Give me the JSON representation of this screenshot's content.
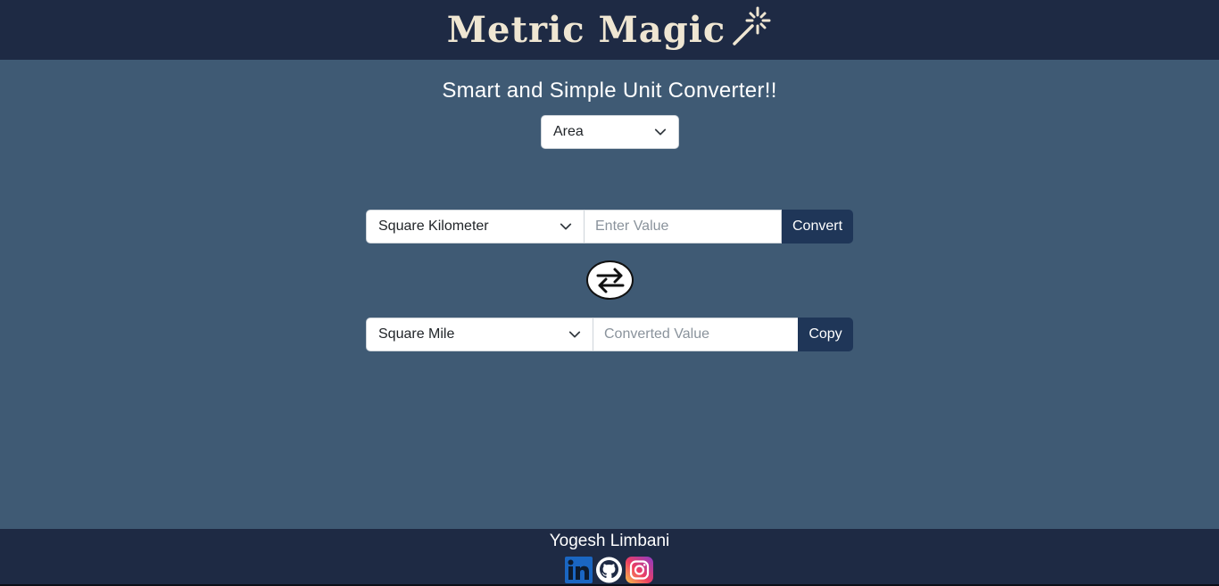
{
  "header": {
    "title": "Metric Magic",
    "logo_icon": "magic-wand-icon"
  },
  "main": {
    "subtitle": "Smart and Simple Unit Converter!!",
    "category_select": {
      "value": "Area"
    },
    "from": {
      "unit": "Square Kilometer",
      "input_placeholder": "Enter Value",
      "input_value": "",
      "button_label": "Convert"
    },
    "swap_icon": "swap-arrows-icon",
    "to": {
      "unit": "Square Mile",
      "output_placeholder": "Converted Value",
      "output_value": "",
      "button_label": "Copy"
    }
  },
  "footer": {
    "author": "Yogesh Limbani",
    "socials": [
      "linkedin-icon",
      "github-icon",
      "instagram-icon"
    ]
  },
  "colors": {
    "header_bg": "#1e2a44",
    "page_bg": "#3f5a74",
    "button_bg": "#1f3658",
    "title_color": "#efe6d2"
  }
}
